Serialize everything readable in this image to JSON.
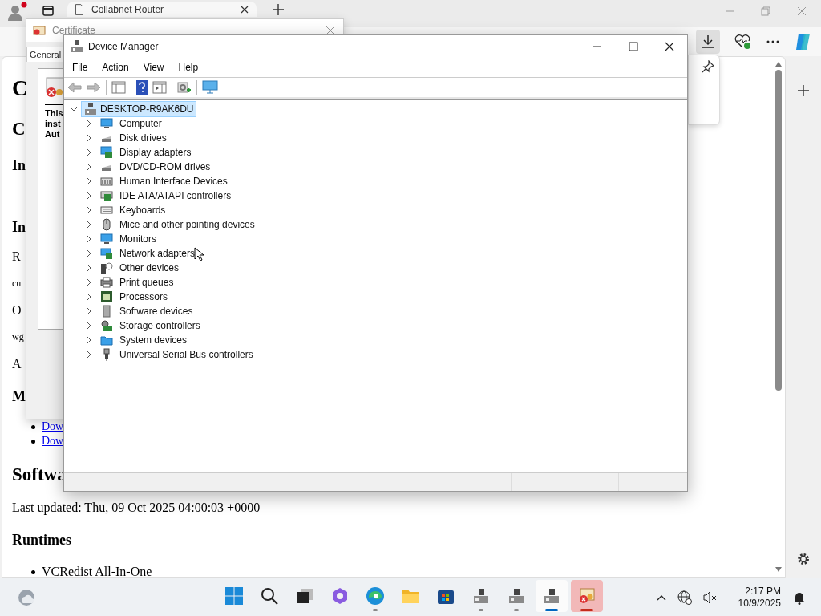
{
  "browser": {
    "tab": {
      "title": "Collabnet Router"
    },
    "page": [
      {
        "kind": "h1",
        "text": "C"
      },
      {
        "kind": "h2",
        "text": "C"
      },
      {
        "kind": "h3",
        "text": "In"
      },
      {
        "kind": "h3gap",
        "text": "In"
      },
      {
        "kind": "p",
        "text": "R"
      },
      {
        "kind": "small",
        "text": "cu"
      },
      {
        "kind": "p",
        "text": "O"
      },
      {
        "kind": "small",
        "text": "wg"
      },
      {
        "kind": "p",
        "text": "A"
      },
      {
        "kind": "h3",
        "text": "M"
      },
      {
        "kind": "link",
        "text": "Dow"
      },
      {
        "kind": "link",
        "text": "Dow"
      },
      {
        "kind": "h2",
        "text": "Softwa"
      },
      {
        "kind": "p",
        "text": "Last updated: Thu, 09 Oct 2025 04:00:03 +0000"
      },
      {
        "kind": "h3",
        "text": "Runtimes"
      },
      {
        "kind": "item",
        "text": "VCRedist All-In-One"
      }
    ]
  },
  "certificate_window": {
    "title": "Certificate",
    "tabs": [
      {
        "label": "General",
        "selected": true
      }
    ],
    "text_lines": [
      "This",
      "inst",
      "Aut"
    ]
  },
  "device_manager": {
    "title": "Device Manager",
    "menu": [
      "File",
      "Action",
      "View",
      "Help"
    ],
    "tree": {
      "label": "DESKTOP-R9AK6DU",
      "expanded": true,
      "selected": true,
      "children": [
        {
          "label": "Computer",
          "kind": "monitor",
          "expanded": false
        },
        {
          "label": "Disk drives",
          "kind": "disk",
          "expanded": false
        },
        {
          "label": "Display adapters",
          "kind": "display",
          "expanded": false
        },
        {
          "label": "DVD/CD-ROM drives",
          "kind": "disk",
          "expanded": false
        },
        {
          "label": "Human Interface Devices",
          "kind": "hid",
          "expanded": false
        },
        {
          "label": "IDE ATA/ATAPI controllers",
          "kind": "card",
          "expanded": false
        },
        {
          "label": "Keyboards",
          "kind": "keyboard",
          "expanded": false
        },
        {
          "label": "Mice and other pointing devices",
          "kind": "mouse",
          "expanded": false
        },
        {
          "label": "Monitors",
          "kind": "monitor",
          "expanded": false
        },
        {
          "label": "Network adapters",
          "kind": "network",
          "expanded": false
        },
        {
          "label": "Other devices",
          "kind": "unknown",
          "expanded": false
        },
        {
          "label": "Print queues",
          "kind": "printer",
          "expanded": false
        },
        {
          "label": "Processors",
          "kind": "chip",
          "expanded": false
        },
        {
          "label": "Software devices",
          "kind": "tower",
          "expanded": false
        },
        {
          "label": "Storage controllers",
          "kind": "storage",
          "expanded": false
        },
        {
          "label": "System devices",
          "kind": "folder",
          "expanded": false
        },
        {
          "label": "Universal Serial Bus controllers",
          "kind": "usb",
          "expanded": false
        }
      ]
    }
  },
  "taskbar": {
    "apps": [
      {
        "kind": "start",
        "open": false,
        "selected": false,
        "flashing": false
      },
      {
        "kind": "search",
        "open": false,
        "selected": false,
        "flashing": false
      },
      {
        "kind": "taskview",
        "open": false,
        "selected": false,
        "flashing": false
      },
      {
        "kind": "copilot",
        "open": false,
        "selected": false,
        "flashing": false
      },
      {
        "kind": "edge",
        "open": true,
        "selected": false,
        "flashing": false
      },
      {
        "kind": "folder",
        "open": false,
        "selected": false,
        "flashing": false
      },
      {
        "kind": "store",
        "open": false,
        "selected": false,
        "flashing": false
      },
      {
        "kind": "devmgr",
        "open": true,
        "selected": false,
        "flashing": false
      },
      {
        "kind": "devmgr",
        "open": true,
        "selected": false,
        "flashing": false
      },
      {
        "kind": "devmgr",
        "open": true,
        "selected": true,
        "flashing": false
      },
      {
        "kind": "cert",
        "open": true,
        "selected": false,
        "flashing": true
      }
    ],
    "time": "2:17 PM",
    "date": "10/9/2025"
  }
}
